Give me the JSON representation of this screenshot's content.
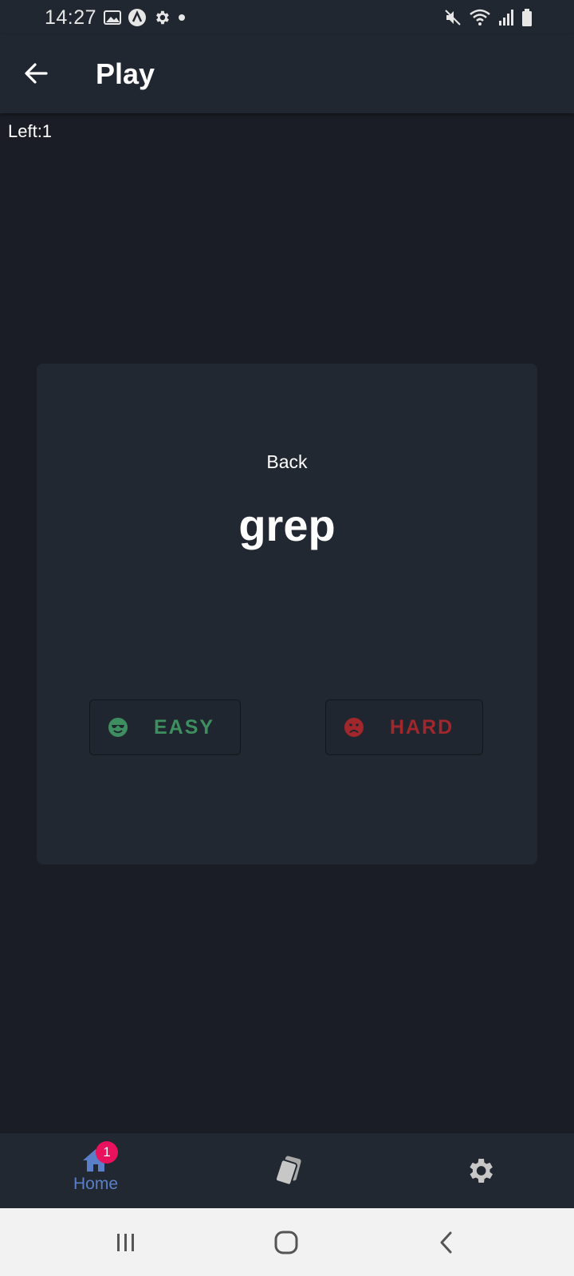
{
  "status_bar": {
    "time": "14:27",
    "left_icons": [
      "gallery-icon",
      "app-a-icon",
      "settings-gear-icon",
      "dot-icon"
    ],
    "right_icons": [
      "mute-icon",
      "wifi-icon",
      "signal-icon",
      "battery-icon"
    ]
  },
  "app_bar": {
    "title": "Play"
  },
  "deck": {
    "left_label": "Left:1"
  },
  "card": {
    "side_label": "Back",
    "word": "grep"
  },
  "buttons": {
    "easy_label": "EASY",
    "hard_label": "HARD"
  },
  "bottom_nav": {
    "home_label": "Home",
    "home_badge": "1",
    "items": [
      "home-icon",
      "cards-icon",
      "settings-icon"
    ]
  },
  "colors": {
    "easy": "#3d8f5f",
    "hard": "#a1272c",
    "accent": "#5b7ec9",
    "badge": "#e8135c"
  }
}
